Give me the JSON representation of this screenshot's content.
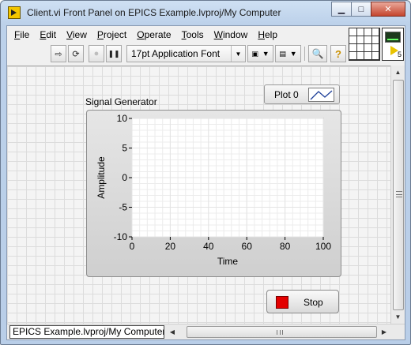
{
  "window": {
    "title": "Client.vi Front Panel on EPICS Example.lvproj/My Computer",
    "minimize_glyph": "▁",
    "maximize_glyph": "□",
    "close_glyph": "✕"
  },
  "menu": [
    {
      "accel": "F",
      "rest": "ile"
    },
    {
      "accel": "E",
      "rest": "dit"
    },
    {
      "accel": "V",
      "rest": "iew"
    },
    {
      "accel": "P",
      "rest": "roject"
    },
    {
      "accel": "O",
      "rest": "perate"
    },
    {
      "accel": "T",
      "rest": "ools"
    },
    {
      "accel": "W",
      "rest": "indow"
    },
    {
      "accel": "H",
      "rest": "elp"
    }
  ],
  "toolbar": {
    "font_name": "17pt Application Font",
    "buttons": [
      {
        "name": "run-arrow-icon",
        "glyph": "⇨"
      },
      {
        "name": "run-continuously-icon",
        "glyph": "⟳"
      },
      {
        "name": "abort-icon",
        "glyph": "●"
      },
      {
        "name": "pause-icon",
        "glyph": "❚❚"
      }
    ],
    "dropdowns": [
      {
        "name": "align-objects-icon",
        "glyph": "▣"
      },
      {
        "name": "distribute-objects-icon",
        "glyph": "▤"
      }
    ],
    "zoom_icon": "🔍",
    "help_icon": "?",
    "vi_number": "5"
  },
  "graph": {
    "label": "Signal Generator",
    "legend_label": "Plot 0"
  },
  "chart_data": {
    "type": "line",
    "title": "",
    "xlabel": "Time",
    "ylabel": "Amplitude",
    "xlim": [
      0,
      100
    ],
    "ylim": [
      -10,
      10
    ],
    "x_ticks": [
      0,
      20,
      40,
      60,
      80,
      100
    ],
    "y_ticks": [
      10,
      5,
      0,
      -5,
      -10
    ],
    "series": [],
    "grid": true,
    "legend": "above-right"
  },
  "controls": {
    "stop_label": "Stop"
  },
  "status": {
    "path": "EPICS Example.lvproj/My Computer"
  },
  "scroll": {
    "up": "▲",
    "down": "▼",
    "left": "◀",
    "right": "▶"
  },
  "colors": {
    "stop_led": "#e30000",
    "plot_background": "#ffffff",
    "grid_line": "#e4e4e4",
    "axis": "#000000"
  }
}
